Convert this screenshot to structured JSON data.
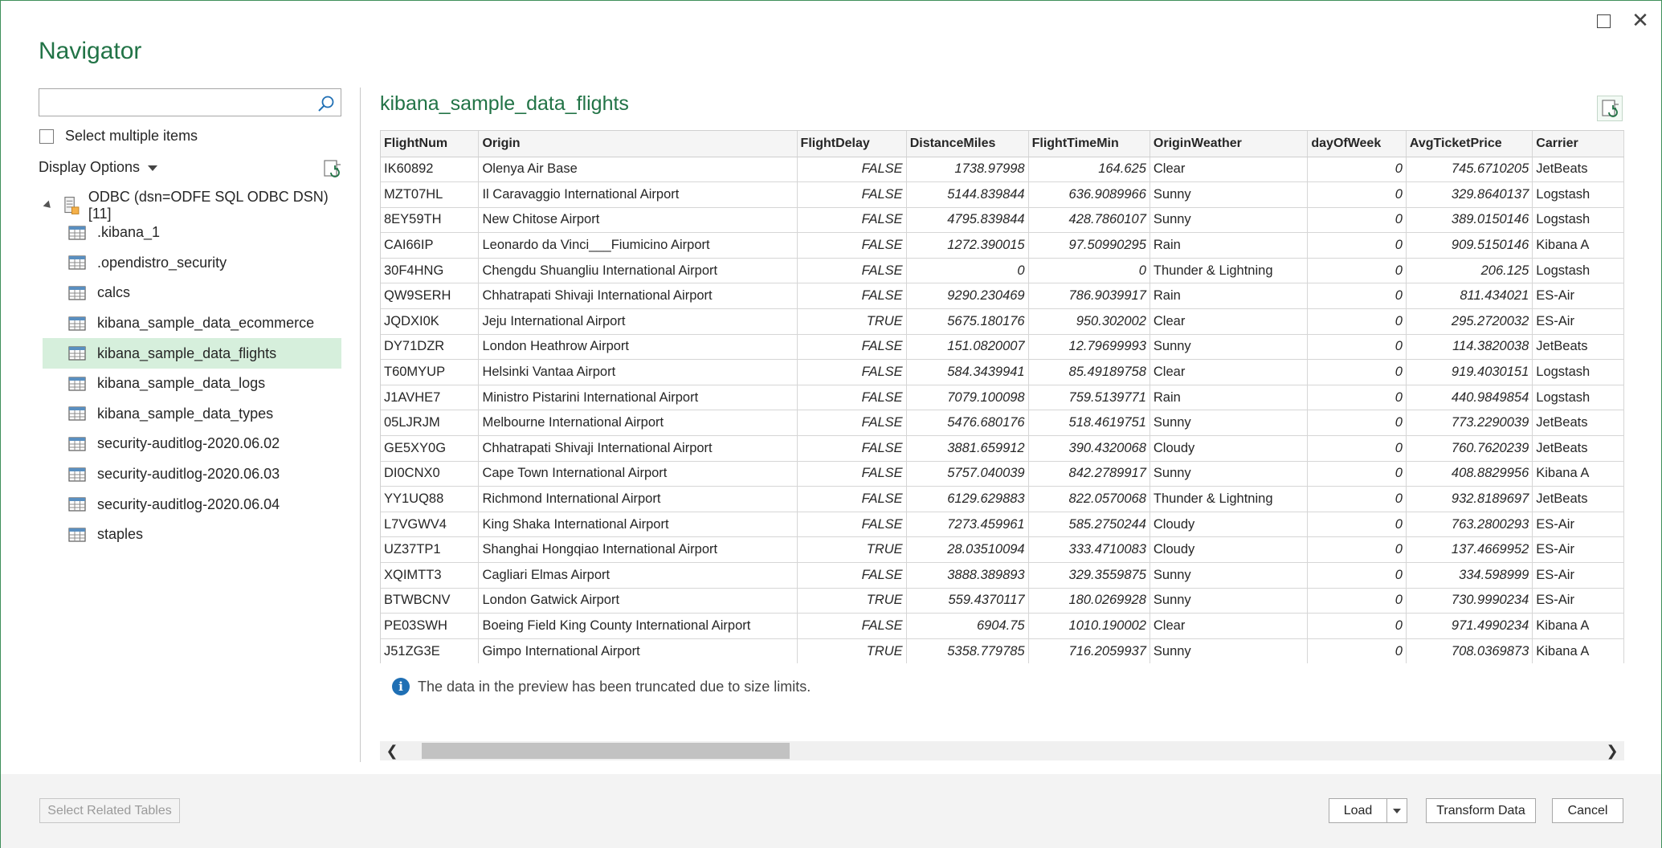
{
  "dialog": {
    "title": "Navigator"
  },
  "left_pane": {
    "search": {
      "value": "",
      "placeholder": ""
    },
    "select_multiple_label": "Select multiple items",
    "display_options_label": "Display Options",
    "tree": {
      "root_label": "ODBC (dsn=ODFE SQL ODBC DSN) [11]",
      "items": [
        {
          "label": ".kibana_1",
          "selected": false
        },
        {
          "label": ".opendistro_security",
          "selected": false
        },
        {
          "label": "calcs",
          "selected": false
        },
        {
          "label": "kibana_sample_data_ecommerce",
          "selected": false
        },
        {
          "label": "kibana_sample_data_flights",
          "selected": true
        },
        {
          "label": "kibana_sample_data_logs",
          "selected": false
        },
        {
          "label": "kibana_sample_data_types",
          "selected": false
        },
        {
          "label": "security-auditlog-2020.06.02",
          "selected": false
        },
        {
          "label": "security-auditlog-2020.06.03",
          "selected": false
        },
        {
          "label": "security-auditlog-2020.06.04",
          "selected": false
        },
        {
          "label": "staples",
          "selected": false
        }
      ]
    }
  },
  "preview": {
    "title": "kibana_sample_data_flights",
    "columns": [
      "FlightNum",
      "Origin",
      "FlightDelay",
      "DistanceMiles",
      "FlightTimeMin",
      "OriginWeather",
      "dayOfWeek",
      "AvgTicketPrice",
      "Carrier"
    ],
    "rows": [
      [
        "IK60892",
        "Olenya Air Base",
        "FALSE",
        "1738.97998",
        "164.625",
        "Clear",
        "0",
        "745.6710205",
        "JetBeats"
      ],
      [
        "MZT07HL",
        "Il Caravaggio International Airport",
        "FALSE",
        "5144.839844",
        "636.9089966",
        "Sunny",
        "0",
        "329.8640137",
        "Logstash"
      ],
      [
        "8EY59TH",
        "New Chitose Airport",
        "FALSE",
        "4795.839844",
        "428.7860107",
        "Sunny",
        "0",
        "389.0150146",
        "Logstash"
      ],
      [
        "CAI66IP",
        "Leonardo da Vinci___Fiumicino Airport",
        "FALSE",
        "1272.390015",
        "97.50990295",
        "Rain",
        "0",
        "909.5150146",
        "Kibana A"
      ],
      [
        "30F4HNG",
        "Chengdu Shuangliu International Airport",
        "FALSE",
        "0",
        "0",
        "Thunder & Lightning",
        "0",
        "206.125",
        "Logstash"
      ],
      [
        "QW9SERH",
        "Chhatrapati Shivaji International Airport",
        "FALSE",
        "9290.230469",
        "786.9039917",
        "Rain",
        "0",
        "811.434021",
        "ES-Air"
      ],
      [
        "JQDXI0K",
        "Jeju International Airport",
        "TRUE",
        "5675.180176",
        "950.302002",
        "Clear",
        "0",
        "295.2720032",
        "ES-Air"
      ],
      [
        "DY71DZR",
        "London Heathrow Airport",
        "FALSE",
        "151.0820007",
        "12.79699993",
        "Sunny",
        "0",
        "114.3820038",
        "JetBeats"
      ],
      [
        "T60MYUP",
        "Helsinki Vantaa Airport",
        "FALSE",
        "584.3439941",
        "85.49189758",
        "Clear",
        "0",
        "919.4030151",
        "Logstash"
      ],
      [
        "J1AVHE7",
        "Ministro Pistarini International Airport",
        "FALSE",
        "7079.100098",
        "759.5139771",
        "Rain",
        "0",
        "440.9849854",
        "Logstash"
      ],
      [
        "05LJRJM",
        "Melbourne International Airport",
        "FALSE",
        "5476.680176",
        "518.4619751",
        "Sunny",
        "0",
        "773.2290039",
        "JetBeats"
      ],
      [
        "GE5XY0G",
        "Chhatrapati Shivaji International Airport",
        "FALSE",
        "3881.659912",
        "390.4320068",
        "Cloudy",
        "0",
        "760.7620239",
        "JetBeats"
      ],
      [
        "DI0CNX0",
        "Cape Town International Airport",
        "FALSE",
        "5757.040039",
        "842.2789917",
        "Sunny",
        "0",
        "408.8829956",
        "Kibana A"
      ],
      [
        "YY1UQ88",
        "Richmond International Airport",
        "FALSE",
        "6129.629883",
        "822.0570068",
        "Thunder & Lightning",
        "0",
        "932.8189697",
        "JetBeats"
      ],
      [
        "L7VGWV4",
        "King Shaka International Airport",
        "FALSE",
        "7273.459961",
        "585.2750244",
        "Cloudy",
        "0",
        "763.2800293",
        "ES-Air"
      ],
      [
        "UZ37TP1",
        "Shanghai Hongqiao International Airport",
        "TRUE",
        "28.03510094",
        "333.4710083",
        "Cloudy",
        "0",
        "137.4669952",
        "ES-Air"
      ],
      [
        "XQIMTT3",
        "Cagliari Elmas Airport",
        "FALSE",
        "3888.389893",
        "329.3559875",
        "Sunny",
        "0",
        "334.598999",
        "ES-Air"
      ],
      [
        "BTWBCNV",
        "London Gatwick Airport",
        "TRUE",
        "559.4370117",
        "180.0269928",
        "Sunny",
        "0",
        "730.9990234",
        "ES-Air"
      ],
      [
        "PE03SWH",
        "Boeing Field King County International Airport",
        "FALSE",
        "6904.75",
        "1010.190002",
        "Clear",
        "0",
        "971.4990234",
        "Kibana A"
      ],
      [
        "J51ZG3E",
        "Gimpo International Airport",
        "TRUE",
        "5358.779785",
        "716.2059937",
        "Sunny",
        "0",
        "708.0369873",
        "Kibana A"
      ]
    ],
    "truncation_notice": "The data in the preview has been truncated due to size limits.",
    "horizontal_scroll": 0.0
  },
  "footer": {
    "select_related_label": "Select Related Tables",
    "load_label": "Load",
    "transform_label": "Transform Data",
    "cancel_label": "Cancel"
  },
  "colors": {
    "accent": "#217346",
    "selected_row": "#d6efdc",
    "info_icon": "#1f6fb4"
  },
  "icons": {
    "search": "search-icon",
    "refresh": "refresh-icon",
    "table": "table-icon",
    "database": "database-icon",
    "info": "info-icon",
    "maximize": "maximize-icon",
    "close": "close-icon"
  }
}
